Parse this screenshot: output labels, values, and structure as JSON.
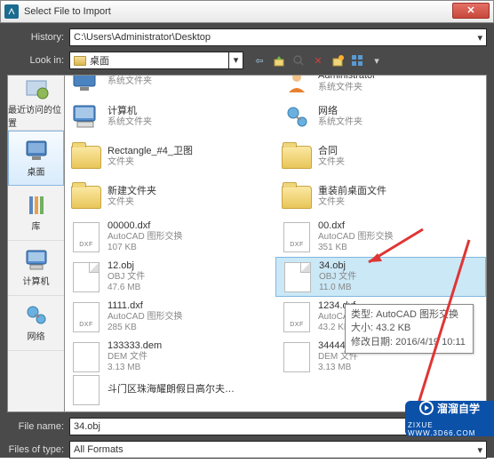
{
  "title": "Select File to Import",
  "history": {
    "label": "History:",
    "value": "C:\\Users\\Administrator\\Desktop"
  },
  "lookin": {
    "label": "Look in:",
    "value": "桌面"
  },
  "places": [
    {
      "id": "recent",
      "label": "最近访问的位置"
    },
    {
      "id": "desktop",
      "label": "桌面"
    },
    {
      "id": "library",
      "label": "库"
    },
    {
      "id": "computer",
      "label": "计算机"
    },
    {
      "id": "network",
      "label": "网络"
    }
  ],
  "files_left": [
    {
      "type": "folder-sys",
      "name": "",
      "sub": "系统文件夹"
    },
    {
      "type": "folder-sys",
      "name": "计算机",
      "sub": "系统文件夹"
    },
    {
      "type": "folder",
      "name": "Rectangle_#4_卫图",
      "sub": "文件夹"
    },
    {
      "type": "folder",
      "name": "新建文件夹",
      "sub": "文件夹"
    },
    {
      "type": "dxf",
      "name": "00000.dxf",
      "sub": "AutoCAD 图形交换",
      "size": "107 KB"
    },
    {
      "type": "obj",
      "name": "12.obj",
      "sub": "OBJ 文件",
      "size": "47.6 MB"
    },
    {
      "type": "dxf",
      "name": "1111.dxf",
      "sub": "AutoCAD 图形交换",
      "size": "285 KB"
    },
    {
      "type": "dem",
      "name": "133333.dem",
      "sub": "DEM 文件",
      "size": "3.13 MB"
    },
    {
      "type": "dem",
      "name": "斗门区珠海耀朗假日高尔夫球会DEM.dem",
      "sub": "",
      "size": ""
    }
  ],
  "files_right": [
    {
      "type": "folder-sys",
      "name": "Administrator",
      "sub": "系统文件夹"
    },
    {
      "type": "folder-sys",
      "name": "网络",
      "sub": "系统文件夹"
    },
    {
      "type": "folder",
      "name": "合同",
      "sub": "文件夹"
    },
    {
      "type": "folder",
      "name": "重装前桌面文件",
      "sub": "文件夹"
    },
    {
      "type": "dxf",
      "name": "00.dxf",
      "sub": "AutoCAD 图形交换",
      "size": "351 KB"
    },
    {
      "type": "obj",
      "name": "34.obj",
      "sub": "OBJ 文件",
      "size": "11.0 MB",
      "selected": true
    },
    {
      "type": "dxf",
      "name": "1234.dxf",
      "sub": "AutoCAD 图形交换",
      "size": "43.2 KB"
    },
    {
      "type": "dem",
      "name": "3444444444444.dem",
      "sub": "DEM 文件",
      "size": "3.13 MB"
    }
  ],
  "tooltip": {
    "line1": "类型: AutoCAD 图形交换",
    "line2": "大小: 43.2 KB",
    "line3": "修改日期: 2016/4/19 10:11"
  },
  "filename": {
    "label": "File name:",
    "value": "34.obj"
  },
  "filetype": {
    "label": "Files of type:",
    "value": "All Formats"
  },
  "watermark": {
    "text1": "溜溜自学",
    "text2": "ZIXUE    WWW.3D66.COM"
  }
}
